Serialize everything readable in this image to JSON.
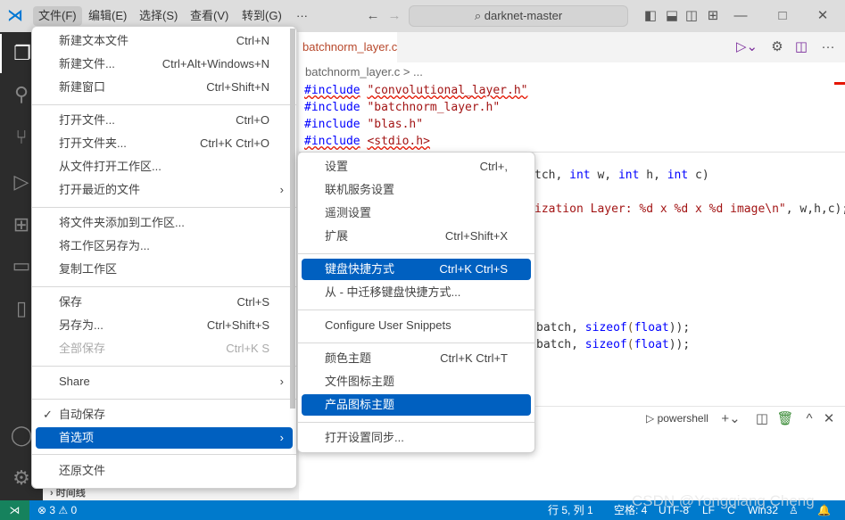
{
  "titlebar": {
    "menus": [
      "文件(F)",
      "编辑(E)",
      "选择(S)",
      "查看(V)",
      "转到(G)"
    ],
    "more": "···",
    "search": "darknet-master"
  },
  "tab": {
    "name": "batchnorm_layer.c",
    "problems": "3"
  },
  "breadcrumb": "batchnorm_layer.c > ...",
  "code": {
    "l1a": "#include",
    "l1b": "\"convolutional_layer.h\"",
    "l2a": "#include",
    "l2b": "\"batchnorm_layer.h\"",
    "l3a": "#include",
    "l3b": "\"blas.h\"",
    "l4a": "#include",
    "l4b": "<stdio.h>",
    "l5a": "tch, ",
    "l5b": "int",
    "l5c": " w, ",
    "l5d": "int",
    "l5e": " h, ",
    "l5f": "int",
    "l5g": " c)",
    "l6a": "ization Layer: %d x %d x %d image\\n\"",
    "l6b": ", w,h,c);",
    "l7a": "batch, ",
    "l7b": "sizeof",
    "l7c": "(",
    "l7d": "float",
    "l7e": "));",
    "l8a": "batch, ",
    "l8b": "sizeof",
    "l8c": "(",
    "l8d": "float",
    "l8e": "));"
  },
  "file_menu": [
    {
      "label": "新建文本文件",
      "shortcut": "Ctrl+N"
    },
    {
      "label": "新建文件...",
      "shortcut": "Ctrl+Alt+Windows+N"
    },
    {
      "label": "新建窗口",
      "shortcut": "Ctrl+Shift+N"
    },
    {
      "label": "打开文件...",
      "shortcut": "Ctrl+O"
    },
    {
      "label": "打开文件夹...",
      "shortcut": "Ctrl+K Ctrl+O"
    },
    {
      "label": "从文件打开工作区...",
      "shortcut": ""
    },
    {
      "label": "打开最近的文件",
      "shortcut": "",
      "submenu": true
    },
    {
      "label": "将文件夹添加到工作区...",
      "shortcut": ""
    },
    {
      "label": "将工作区另存为...",
      "shortcut": ""
    },
    {
      "label": "复制工作区",
      "shortcut": ""
    },
    {
      "label": "保存",
      "shortcut": "Ctrl+S"
    },
    {
      "label": "另存为...",
      "shortcut": "Ctrl+Shift+S"
    },
    {
      "label": "全部保存",
      "shortcut": "Ctrl+K S",
      "disabled": true
    },
    {
      "label": "Share",
      "shortcut": "",
      "submenu": true
    },
    {
      "label": "自动保存",
      "shortcut": "",
      "checked": true
    },
    {
      "label": "首选项",
      "shortcut": "",
      "submenu": true,
      "selected": true
    },
    {
      "label": "还原文件",
      "shortcut": ""
    }
  ],
  "prefs_menu": [
    {
      "label": "设置",
      "shortcut": "Ctrl+,"
    },
    {
      "label": "联机服务设置",
      "shortcut": ""
    },
    {
      "label": "遥测设置",
      "shortcut": ""
    },
    {
      "label": "扩展",
      "shortcut": "Ctrl+Shift+X"
    },
    {
      "label": "键盘快捷方式",
      "shortcut": "Ctrl+K Ctrl+S",
      "selected": true
    },
    {
      "label": "从 - 中迁移键盘快捷方式...",
      "shortcut": ""
    },
    {
      "label": "Configure User Snippets",
      "shortcut": ""
    },
    {
      "label": "颜色主题",
      "shortcut": "Ctrl+K Ctrl+T"
    },
    {
      "label": "文件图标主题",
      "shortcut": ""
    },
    {
      "label": "产品图标主题",
      "shortcut": "",
      "selected": true
    },
    {
      "label": "打开设置同步...",
      "shortcut": ""
    }
  ],
  "sidebar": {
    "timeline": "时间线"
  },
  "panel": {
    "terminal": "powershell"
  },
  "status": {
    "errors": "3",
    "warnings": "0",
    "position": "行 5, 列 1",
    "spaces": "空格: 4",
    "encoding": "UTF-8",
    "eol": "LF",
    "lang": "C",
    "platform": "Win32"
  },
  "watermark": "CSDN @Yongqiang Cheng",
  "colors": {
    "accent": "#0060c0",
    "status": "#007acc",
    "remote": "#16825d"
  }
}
